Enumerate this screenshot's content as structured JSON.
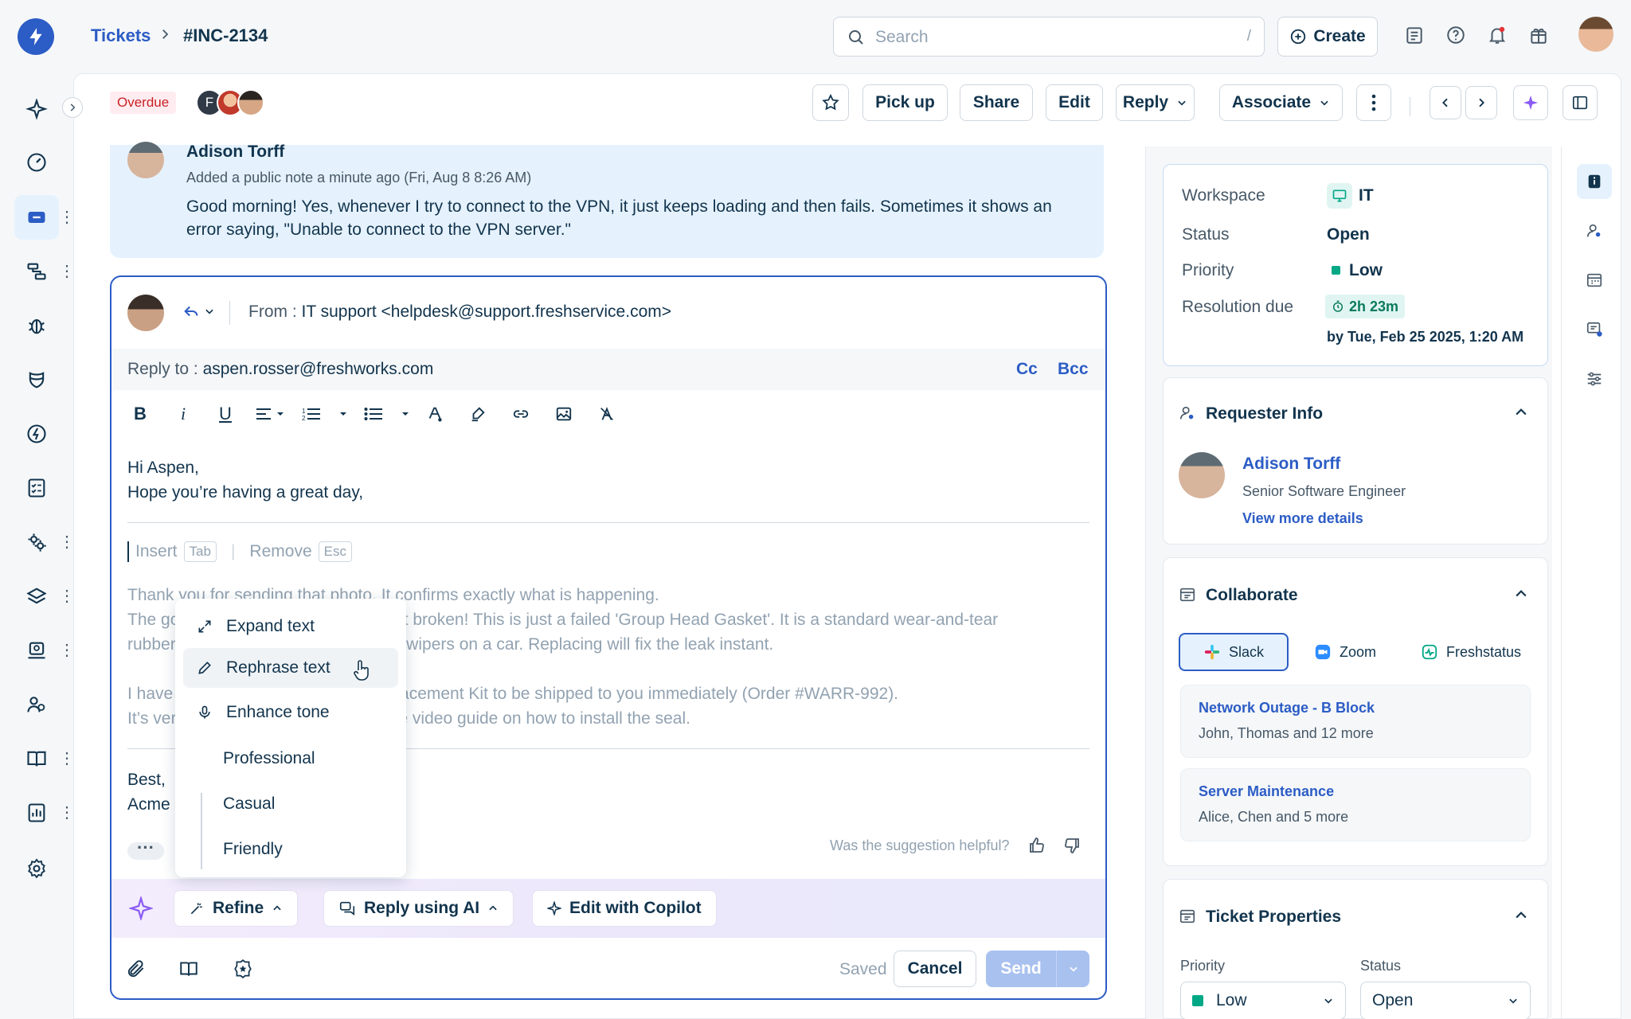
{
  "breadcrumb": {
    "parent": "Tickets",
    "current": "#INC-2134"
  },
  "search": {
    "placeholder": "Search",
    "shortcut": "/"
  },
  "topbar": {
    "create_label": "Create"
  },
  "ticket": {
    "status_tag": "Overdue",
    "agents_initial": "F",
    "actions": {
      "pick_up": "Pick up",
      "share": "Share",
      "edit": "Edit",
      "reply": "Reply",
      "associate": "Associate"
    }
  },
  "note": {
    "author": "Adison Torff",
    "meta": "Added a public note a minute ago (Fri, Aug 8 8:26 AM)",
    "body": "Good morning! Yes, whenever I try to connect to the VPN, it just keeps loading and then fails. Sometimes it shows an error saying, \"Unable to connect to the VPN server.\""
  },
  "composer": {
    "from_label": "From :",
    "from_value": "IT support <helpdesk@support.freshservice.com>",
    "reply_to_label": "Reply to :",
    "reply_to_value": "aspen.rosser@freshworks.com",
    "cc": "Cc",
    "bcc": "Bcc",
    "greeting_line1": "Hi Aspen,",
    "greeting_line2": "Hope you’re having a great day,",
    "insert_label": "Insert",
    "insert_key": "Tab",
    "remove_label": "Remove",
    "remove_key": "Esc",
    "suggestion": {
      "line1": "Thank you for sending that photo. It confirms exactly what is happening.",
      "line2": "The good news is your machine is not broken! This is just a failed 'Group Head Gasket'. It is a standard wear-and-tear",
      "line3": "rubber seal, much like the windshield wipers on a car. Replacing will fix the leak instant.",
      "line4": "I have authorized a free Gasket Replacement Kit to be shipped to you immediately (Order #WARR-992).",
      "line5": "It’s very easy to fix; here is a 2-minute video guide on how to install the seal."
    },
    "sign_line1": "Best,",
    "sign_line2": "Acme",
    "helpful_prompt": "Was the suggestion helpful?",
    "ai_refine": "Refine",
    "ai_reply": "Reply using AI",
    "ai_copilot": "Edit with Copilot",
    "saved": "Saved",
    "cancel": "Cancel",
    "send": "Send"
  },
  "refine_menu": {
    "expand": "Expand text",
    "rephrase": "Rephrase text",
    "enhance": "Enhance tone",
    "professional": "Professional",
    "casual": "Casual",
    "friendly": "Friendly"
  },
  "details": {
    "workspace_label": "Workspace",
    "workspace_value": "IT",
    "status_label": "Status",
    "status_value": "Open",
    "priority_label": "Priority",
    "priority_value": "Low",
    "resolution_label": "Resolution due",
    "resolution_timer": "2h 23m",
    "resolution_date": "by Tue, Feb 25 2025, 1:20 AM"
  },
  "requester": {
    "title": "Requester Info",
    "name": "Adison Torff",
    "role": "Senior Software Engineer",
    "more": "View more details"
  },
  "collaborate": {
    "title": "Collaborate",
    "tabs": [
      "Slack",
      "Zoom",
      "Freshstatus"
    ],
    "channels": [
      {
        "title": "Network Outage - B Block",
        "sub": "John, Thomas and 12 more"
      },
      {
        "title": "Server Maintenance",
        "sub": "Alice, Chen and 5 more"
      }
    ]
  },
  "properties": {
    "title": "Ticket Properties",
    "priority_label": "Priority",
    "priority_value": "Low",
    "status_label": "Status",
    "status_value": "Open"
  },
  "colors": {
    "brand": "#2c5cc5",
    "ai": "#8b5cf6",
    "low": "#00a886",
    "overdue": "#c82124"
  }
}
